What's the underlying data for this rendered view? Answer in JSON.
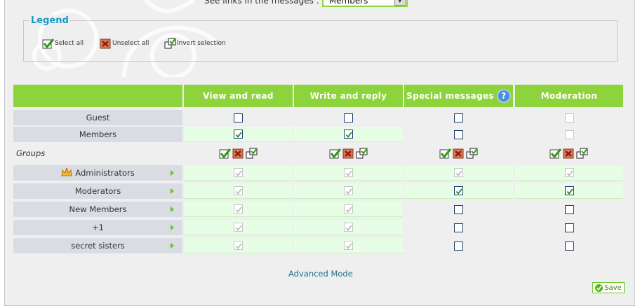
{
  "filter": {
    "label": "See links in the messages :",
    "selected": "Members"
  },
  "legend": {
    "title": "Legend",
    "select_all": "Select all",
    "unselect_all": "Unselect all",
    "invert_selection": "Invert selection"
  },
  "columns": [
    "View and read",
    "Write and reply",
    "Special messages",
    "Moderation"
  ],
  "rows": [
    {
      "label": "Guest",
      "values": [
        false,
        false,
        false,
        false
      ],
      "disabled": [
        false,
        false,
        false,
        true
      ]
    },
    {
      "label": "Members",
      "values": [
        true,
        true,
        false,
        false
      ],
      "disabled": [
        false,
        false,
        false,
        true
      ]
    }
  ],
  "groups_label": "Groups",
  "groups": [
    {
      "label": "Administrators",
      "crown": true,
      "values": [
        true,
        true,
        true,
        true
      ],
      "disabled": [
        true,
        true,
        true,
        true
      ]
    },
    {
      "label": "Moderators",
      "values": [
        true,
        true,
        true,
        true
      ],
      "disabled": [
        true,
        true,
        false,
        false
      ]
    },
    {
      "label": "New Members",
      "values": [
        true,
        true,
        false,
        false
      ],
      "disabled": [
        true,
        true,
        false,
        false
      ]
    },
    {
      "label": "+1",
      "values": [
        true,
        true,
        false,
        false
      ],
      "disabled": [
        true,
        true,
        false,
        false
      ]
    },
    {
      "label": "secret sisters",
      "values": [
        true,
        true,
        false,
        false
      ],
      "disabled": [
        true,
        true,
        false,
        false
      ]
    }
  ],
  "advanced_mode": "Advanced Mode",
  "save": "Save",
  "help_glyph": "?",
  "colors": {
    "accent": "#8dd33b",
    "title_blue": "#1b9bc4",
    "row_label_bg": "#d9dde3",
    "cell_green": "#e8fde5"
  }
}
